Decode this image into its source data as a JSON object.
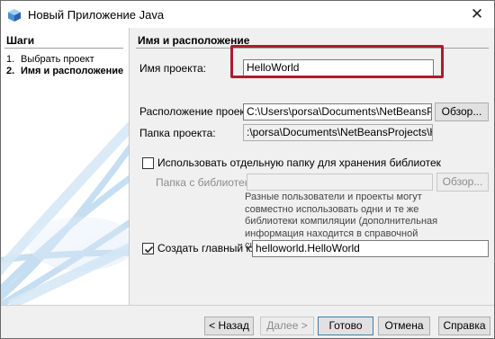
{
  "window": {
    "title": "Новый Приложение Java",
    "close_glyph": "✕"
  },
  "steps": {
    "title": "Шаги",
    "items": [
      {
        "num": "1.",
        "label": "Выбрать проект"
      },
      {
        "num": "2.",
        "label": "Имя и расположение"
      }
    ]
  },
  "form": {
    "section_title": "Имя и расположение",
    "project_name": {
      "label": "Имя проекта:",
      "value": "HelloWorld"
    },
    "project_location": {
      "label": "Расположение проекта:",
      "value": "C:\\Users\\porsa\\Documents\\NetBeansProjects",
      "browse_label": "Обзор..."
    },
    "project_folder": {
      "label": "Папка проекта:",
      "value": ":\\porsa\\Documents\\NetBeansProjects\\HelloWorld"
    },
    "separate_lib": {
      "label": "Использовать отдельную папку для хранения библиотек",
      "checked": false
    },
    "lib_folder": {
      "label": "Папка с библиотеками:",
      "value": "",
      "browse_label": "Обзор..."
    },
    "lib_info": "Разные пользователи и проекты могут совместно использовать одни и те же библиотеки компиляции (дополнительная информация находится в справочной системе).",
    "main_class": {
      "label": "Создать главный класс",
      "checked": true,
      "value": "helloworld.HelloWorld"
    }
  },
  "buttons": {
    "back": "< Назад",
    "next": "Далее >",
    "finish": "Готово",
    "cancel": "Отмена",
    "help": "Справка"
  },
  "colors": {
    "highlight": "#b01a2e",
    "accent": "#3c7fb1"
  }
}
